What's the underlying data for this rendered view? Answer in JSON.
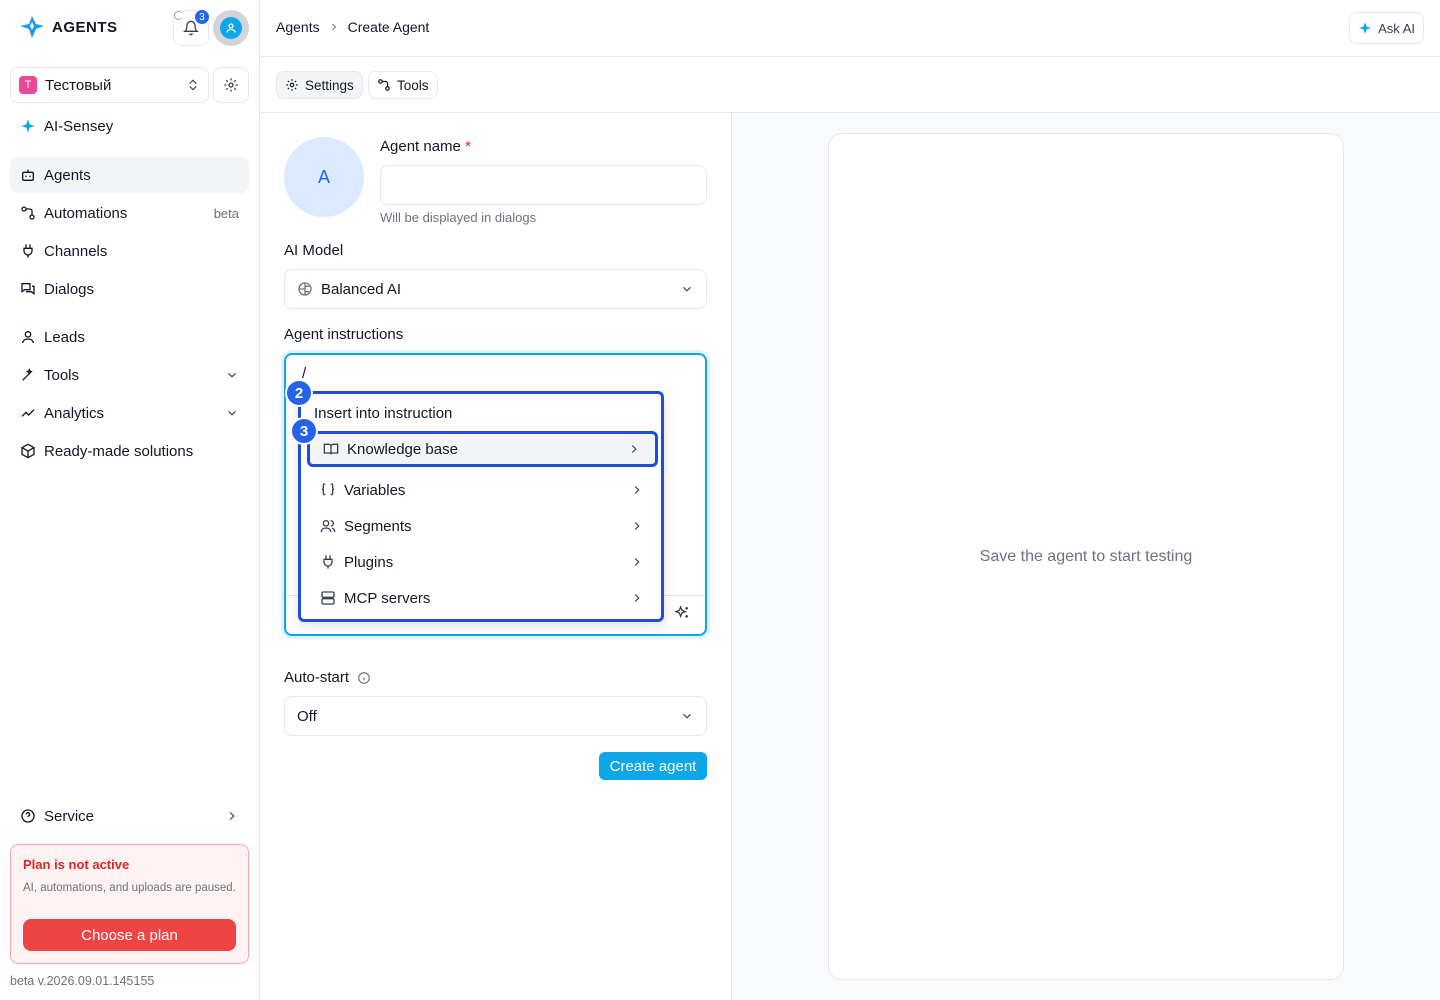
{
  "app": {
    "logo_text": "AGENTS",
    "notifications_count": "3"
  },
  "workspace": {
    "badge": "T",
    "name": "Тестовый"
  },
  "sidebar": {
    "items": [
      {
        "label": "AI-Sensey",
        "icon": "sparkle-icon"
      },
      {
        "label": "Agents",
        "icon": "bot-icon",
        "active": true
      },
      {
        "label": "Automations",
        "icon": "workflow-icon",
        "badge": "beta"
      },
      {
        "label": "Channels",
        "icon": "plug-icon"
      },
      {
        "label": "Dialogs",
        "icon": "messages-icon"
      },
      {
        "label": "Leads",
        "icon": "user-icon"
      },
      {
        "label": "Tools",
        "icon": "wand-icon"
      },
      {
        "label": "Analytics",
        "icon": "chart-icon"
      },
      {
        "label": "Ready-made solutions",
        "icon": "box-icon"
      }
    ],
    "service_label": "Service",
    "plan": {
      "title": "Plan is not active",
      "description": "AI, automations, and uploads are paused.",
      "button": "Choose a plan"
    },
    "version": "beta v.2026.09.01.145155"
  },
  "header": {
    "breadcrumb": [
      "Agents",
      "Create Agent"
    ],
    "ask_ai": "Ask AI"
  },
  "tabs": [
    {
      "label": "Settings",
      "active": true
    },
    {
      "label": "Tools",
      "active": false
    }
  ],
  "form": {
    "avatar_letter": "A",
    "agent_name_label": "Agent name",
    "required_mark": "*",
    "agent_name_value": "",
    "agent_name_hint": "Will be displayed in dialogs",
    "model_label": "AI Model",
    "model_value": "Balanced AI",
    "instructions_label": "Agent instructions",
    "instructions_value": "/",
    "autostart_label": "Auto-start",
    "autostart_value": "Off",
    "create_button": "Create agent"
  },
  "insert_menu": {
    "title": "Insert into instruction",
    "items": [
      {
        "label": "Knowledge base",
        "icon": "book-icon"
      },
      {
        "label": "Variables",
        "icon": "braces-icon"
      },
      {
        "label": "Segments",
        "icon": "users-icon"
      },
      {
        "label": "Plugins",
        "icon": "plug-icon"
      },
      {
        "label": "MCP servers",
        "icon": "server-icon"
      }
    ]
  },
  "markers": [
    "2",
    "3"
  ],
  "preview": {
    "empty_text": "Save the agent to start testing"
  },
  "colors": {
    "accent": "#0ea5e9",
    "marker": "#2563eb",
    "danger": "#ef4444"
  }
}
